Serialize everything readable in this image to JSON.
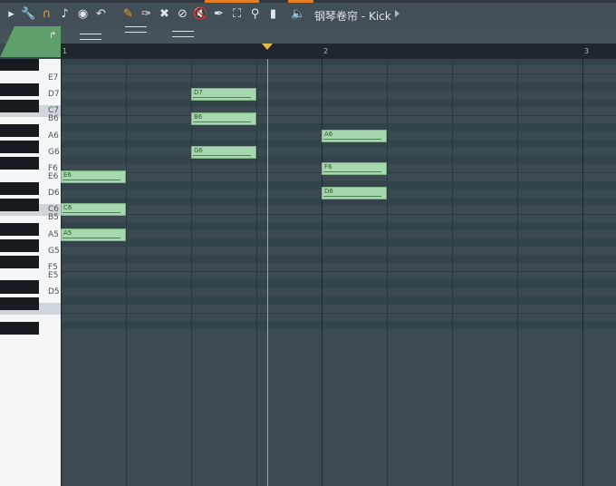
{
  "app": {
    "title": "钢琴卷帘 - Kick",
    "toolbar_icons": [
      "play-arrow-icon",
      "wrench-icon",
      "magnet-icon",
      "note-icon",
      "stop-circle-icon",
      "undo-icon",
      "pencil-icon",
      "paint-icon",
      "delete-icon",
      "mute-icon",
      "slice-icon",
      "select-icon",
      "zoom-icon",
      "speaker-icon",
      "volume-icon"
    ]
  },
  "ruler": {
    "bars": [
      "1",
      "2",
      "3"
    ]
  },
  "keyboard": {
    "labels": [
      "E7",
      "D7",
      "C7",
      "B6",
      "A6",
      "G6",
      "F6",
      "E6",
      "D6",
      "C6",
      "B5",
      "A5",
      "G5",
      "F5",
      "E5",
      "D5"
    ]
  },
  "notes": [
    {
      "label": "D7",
      "pitch": "D7",
      "start_step": 4,
      "length_steps": 2
    },
    {
      "label": "B6",
      "pitch": "B6",
      "start_step": 4,
      "length_steps": 2
    },
    {
      "label": "A6",
      "pitch": "A6",
      "start_step": 8,
      "length_steps": 2
    },
    {
      "label": "G6",
      "pitch": "G6",
      "start_step": 4,
      "length_steps": 2
    },
    {
      "label": "F6",
      "pitch": "F6",
      "start_step": 8,
      "length_steps": 2
    },
    {
      "label": "E6",
      "pitch": "E6",
      "start_step": 0,
      "length_steps": 2
    },
    {
      "label": "D6",
      "pitch": "D6",
      "start_step": 8,
      "length_steps": 2
    },
    {
      "label": "C6",
      "pitch": "C6",
      "start_step": 0,
      "length_steps": 2
    },
    {
      "label": "A5",
      "pitch": "A5",
      "start_step": 0,
      "length_steps": 2
    }
  ],
  "colors": {
    "note_fill": "#a7d7ac",
    "accent": "#e67e22",
    "marker": "#e2bc46"
  }
}
